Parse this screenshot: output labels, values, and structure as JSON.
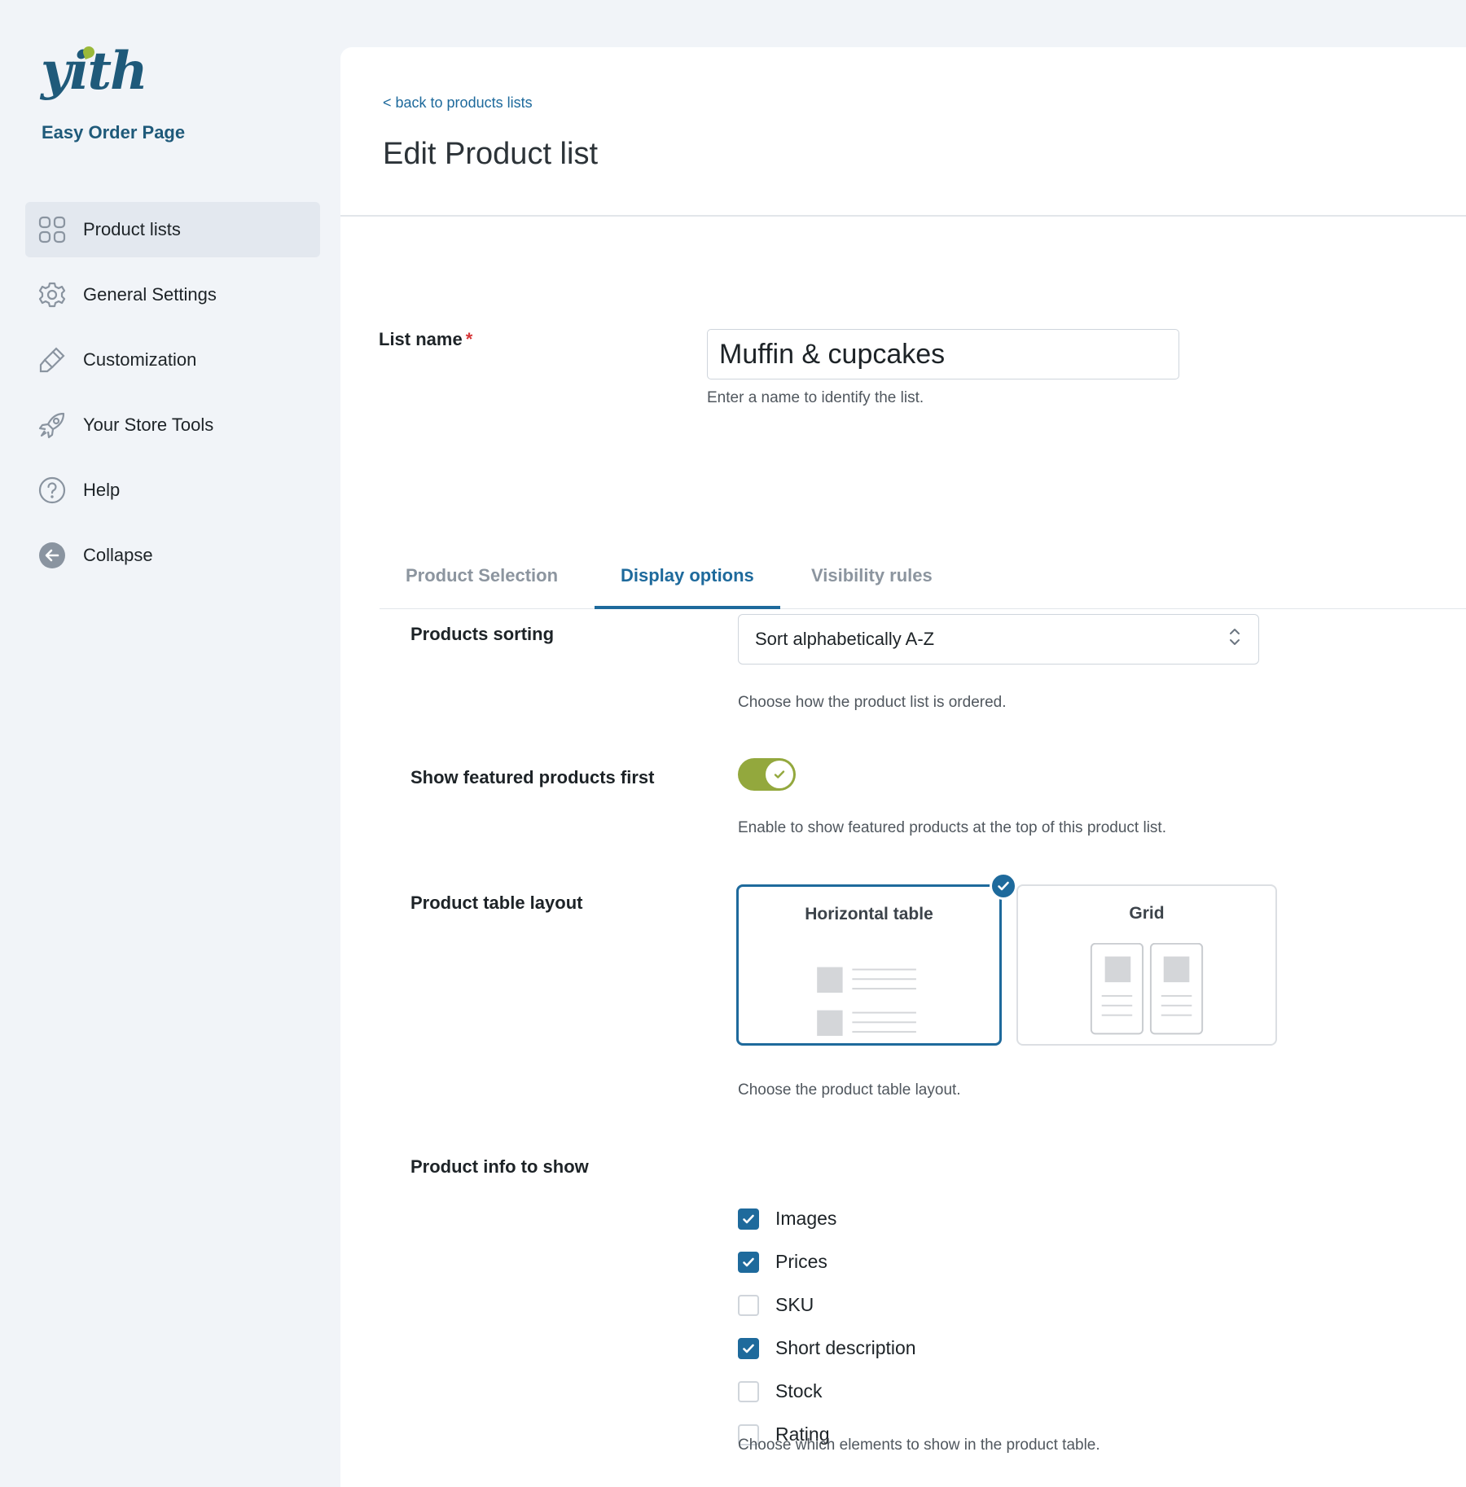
{
  "brand": {
    "logo": "yith",
    "subtitle": "Easy Order Page"
  },
  "sidebar": {
    "items": [
      {
        "label": "Product lists",
        "icon": "grid-icon",
        "active": true
      },
      {
        "label": "General Settings",
        "icon": "gear-icon"
      },
      {
        "label": "Customization",
        "icon": "brush-icon"
      },
      {
        "label": "Your Store Tools",
        "icon": "rocket-icon"
      },
      {
        "label": "Help",
        "icon": "help-icon"
      },
      {
        "label": "Collapse",
        "icon": "collapse-arrow-icon"
      }
    ]
  },
  "header": {
    "back_link": "< back to products lists",
    "title": "Edit Product list"
  },
  "list_name": {
    "label": "List name",
    "required_mark": "*",
    "value": "Muffin & cupcakes",
    "help": "Enter a name to identify the list."
  },
  "tabs": [
    {
      "label": "Product Selection"
    },
    {
      "label": "Display options",
      "active": true
    },
    {
      "label": "Visibility rules"
    }
  ],
  "sorting": {
    "label": "Products sorting",
    "selected": "Sort alphabetically A-Z",
    "help": "Choose how the product list is ordered."
  },
  "featured": {
    "label": "Show featured products first",
    "enabled": true,
    "help": "Enable to show featured products at the top of this product list."
  },
  "layout": {
    "label": "Product table layout",
    "options": [
      {
        "label": "Horizontal table",
        "selected": true
      },
      {
        "label": "Grid",
        "selected": false
      }
    ],
    "help": "Choose the product table layout."
  },
  "product_info": {
    "label": "Product info to show",
    "options": [
      {
        "label": "Images",
        "checked": true
      },
      {
        "label": "Prices",
        "checked": true
      },
      {
        "label": "SKU",
        "checked": false
      },
      {
        "label": "Short description",
        "checked": true
      },
      {
        "label": "Stock",
        "checked": false
      },
      {
        "label": "Rating",
        "checked": false
      }
    ],
    "help": "Choose which elements to show in the product table."
  },
  "colors": {
    "accent": "#1e6a9c",
    "toggle_on": "#93a83d",
    "brand": "#1f5a7a",
    "required": "#d63638"
  }
}
